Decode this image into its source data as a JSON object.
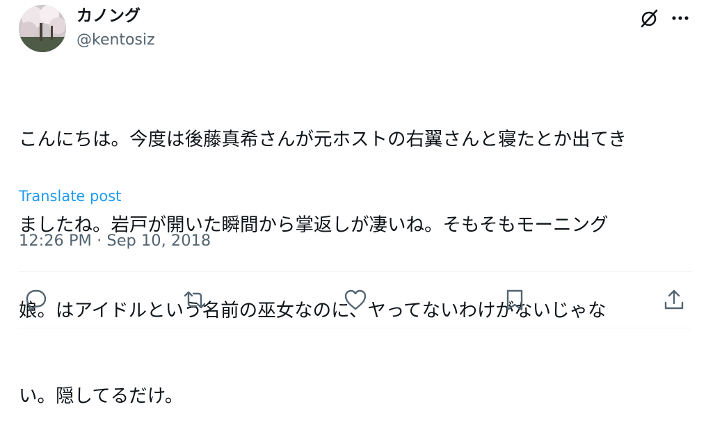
{
  "author": {
    "display_name": "カノング",
    "handle": "@kentosiz"
  },
  "post": {
    "lines": [
      "こんにちは。今度は後藤真希さんが元ホストの右翼さんと寝たとか出てき",
      "ましたね。岩戸が開いた瞬間から掌返しが凄いね。そもそもモーニング",
      "娘。はアイドルという名前の巫女なのに、ヤってないわけがないじゃな",
      "い。隠してるだけ。"
    ],
    "translate_label": "Translate post",
    "timestamp": "12:26 PM · Sep 10, 2018"
  },
  "icons": {
    "header": [
      "grok-icon",
      "more-icon"
    ],
    "actions": [
      "reply-icon",
      "repost-icon",
      "like-icon",
      "bookmark-icon",
      "share-icon"
    ]
  },
  "colors": {
    "text": "#0f1419",
    "secondary": "#536471",
    "link": "#1d9bf0",
    "divider": "#eff3f4"
  }
}
